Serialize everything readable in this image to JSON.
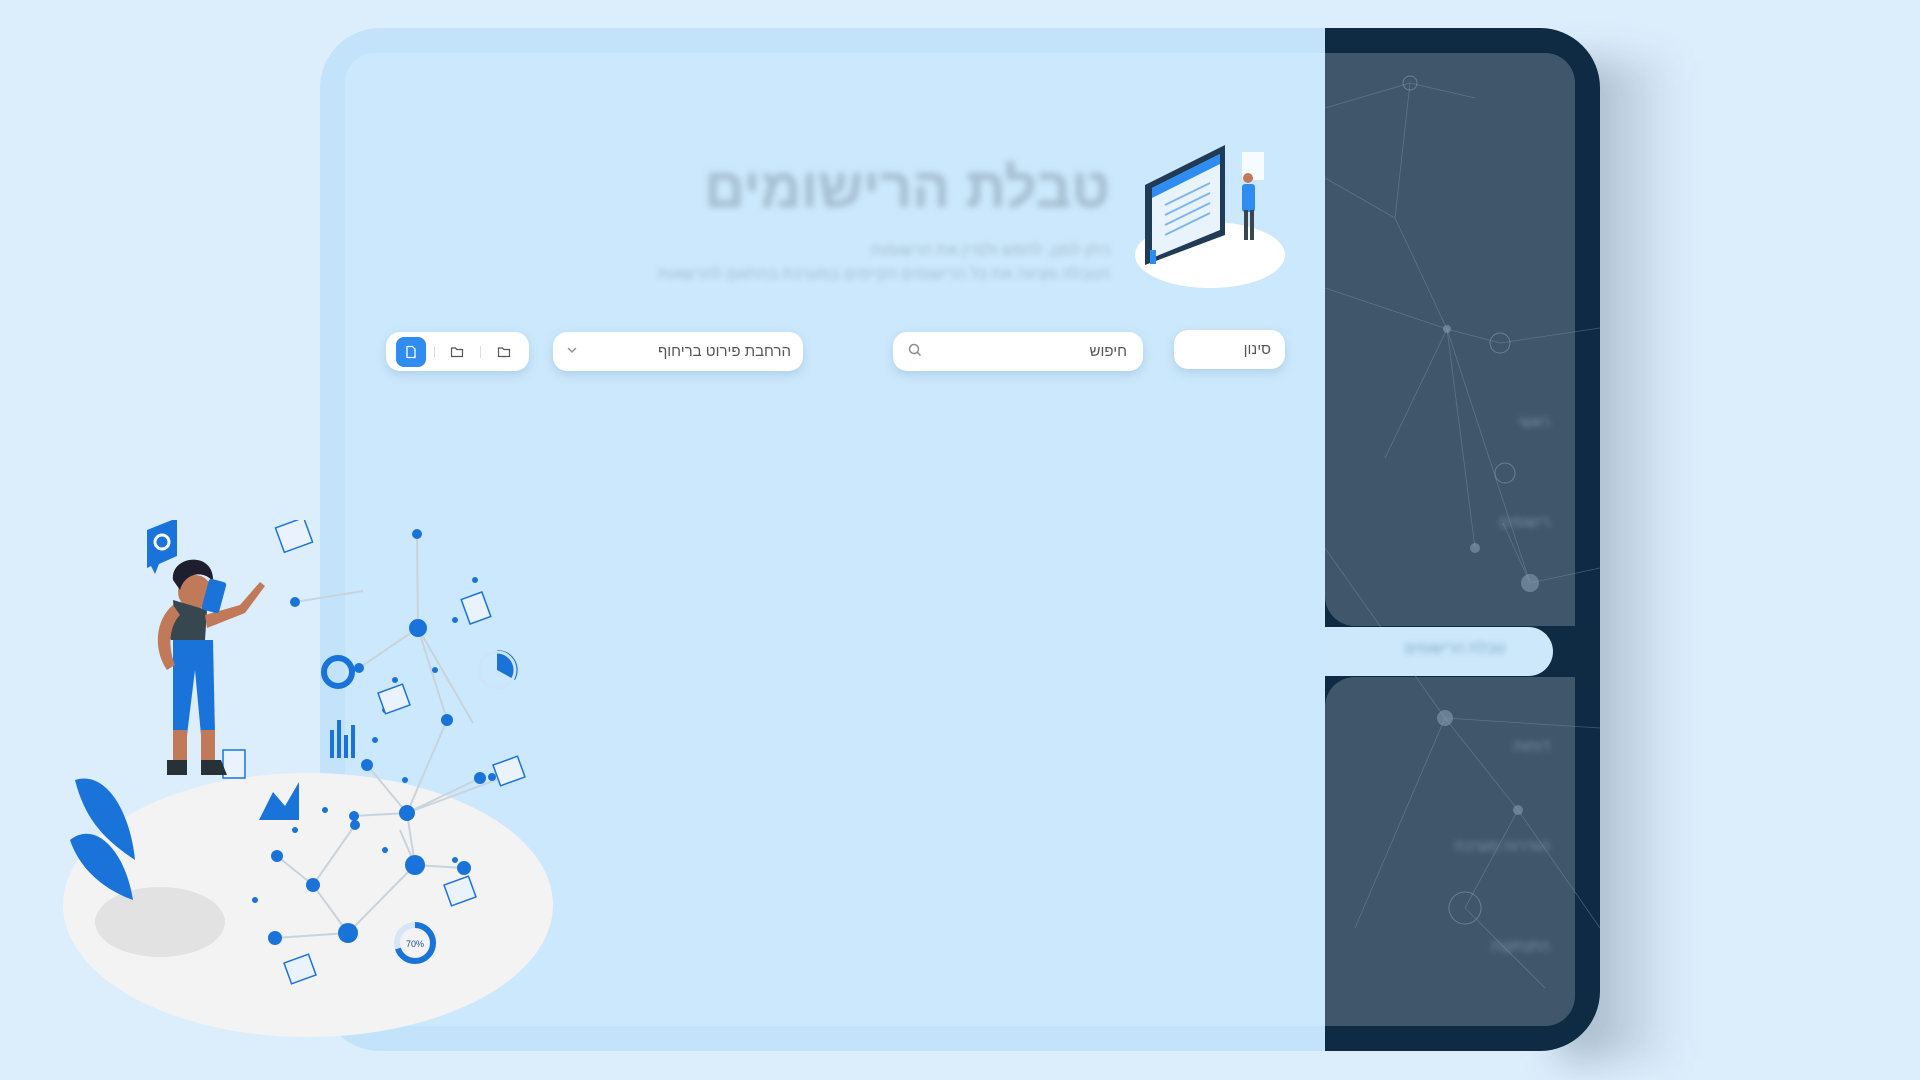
{
  "header": {
    "title": "טבלת הרישומים",
    "subtitle_line1": "ניתן לסנן, לחפש ולמיין את הרשומות",
    "subtitle_line2": "הטבלה מציגה את כל הרישומים הקיימים במערכת בהתאם להרשאות"
  },
  "toolbar": {
    "filter_label": "סינון",
    "search_placeholder": "חיפוש",
    "expand_select_value": "הרחבת פירוט בריחוף"
  },
  "sidebar": {
    "items": [
      {
        "label": "ראשי"
      },
      {
        "label": "רישומים"
      },
      {
        "label": "טבלת הרישומים"
      },
      {
        "label": "דוחות"
      },
      {
        "label": "הגדרות מערכת"
      },
      {
        "label": "התנתקות"
      }
    ]
  },
  "colors": {
    "accent": "#2f8cf0",
    "sidebar_bg": "#0f2a43",
    "sidebar_card": "#40576b",
    "content_bg": "#cce8fc"
  },
  "illustration": {
    "percent_label": "70%"
  }
}
